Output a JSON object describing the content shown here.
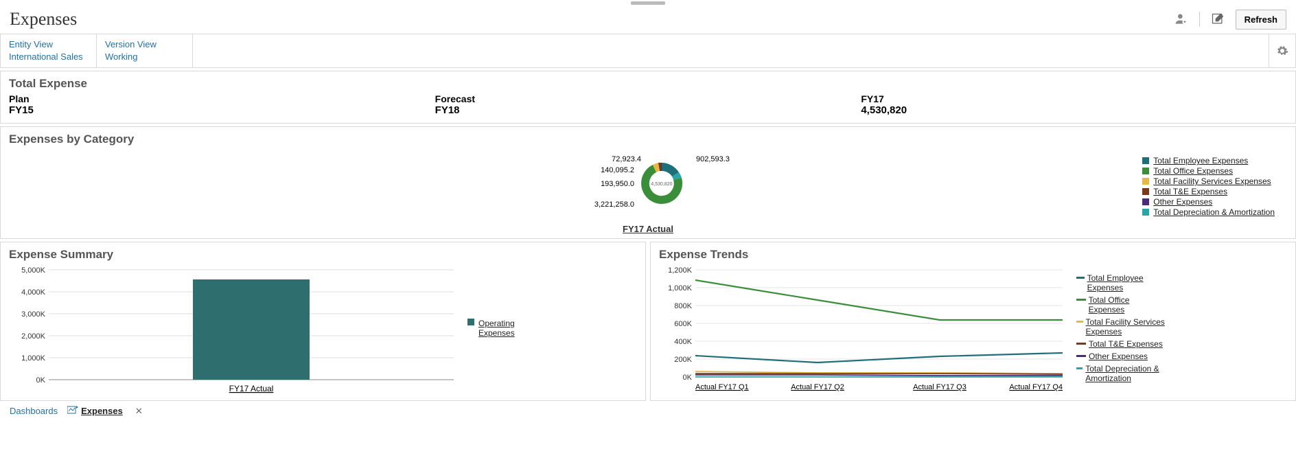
{
  "page_title": "Expenses",
  "refresh_label": "Refresh",
  "pov": {
    "entity": {
      "label": "Entity View",
      "value": "International Sales"
    },
    "version": {
      "label": "Version View",
      "value": "Working"
    }
  },
  "total_expense": {
    "title": "Total Expense",
    "cols": [
      {
        "label": "Plan",
        "value": "FY15"
      },
      {
        "label": "Forecast",
        "value": "FY18"
      },
      {
        "label": "FY17",
        "value": "4,530,820"
      }
    ]
  },
  "ebc": {
    "title": "Expenses by Category",
    "caption": "FY17 Actual",
    "center_value": "4,530,820",
    "labels": [
      "902,593.3",
      "72,923.4",
      "140,095.2",
      "193,950.0",
      "3,221,258.0"
    ],
    "legend": [
      {
        "color": "#1f6f78",
        "label": "Total Employee Expenses"
      },
      {
        "color": "#3a8e3a",
        "label": "Total Office Expenses"
      },
      {
        "color": "#e6b84a",
        "label": "Total Facility Services Expenses"
      },
      {
        "color": "#7a3a1a",
        "label": "Total T&E Expenses"
      },
      {
        "color": "#4a2a7a",
        "label": "Other Expenses"
      },
      {
        "color": "#2aa5a5",
        "label": "Total Depreciation & Amortization"
      }
    ]
  },
  "summary": {
    "title": "Expense Summary",
    "y_ticks": [
      "5,000K",
      "4,000K",
      "3,000K",
      "2,000K",
      "1,000K",
      "0K"
    ],
    "x_label": "FY17 Actual",
    "legend": [
      {
        "color": "#2e6e6e",
        "label": "Operating Expenses"
      }
    ]
  },
  "trends": {
    "title": "Expense Trends",
    "y_ticks": [
      "1,200K",
      "1,000K",
      "800K",
      "600K",
      "400K",
      "200K",
      "0K"
    ],
    "x_labels": [
      "Actual FY17 Q1",
      "Actual FY17 Q2",
      "Actual FY17 Q3",
      "Actual FY17 Q4"
    ],
    "legend": [
      {
        "color": "#1f6f78",
        "label": "Total Employee Expenses"
      },
      {
        "color": "#3a8e3a",
        "label": "Total Office Expenses"
      },
      {
        "color": "#e6b84a",
        "label": "Total Facility Services Expenses"
      },
      {
        "color": "#7a3a1a",
        "label": "Total T&E Expenses"
      },
      {
        "color": "#4a2a7a",
        "label": "Other Expenses"
      },
      {
        "color": "#2aa5a5",
        "label": "Total Depreciation & Amortization"
      }
    ]
  },
  "tabs": {
    "dashboards": "Dashboards",
    "expenses": "Expenses"
  },
  "chart_data": [
    {
      "type": "pie",
      "title": "Expenses by Category — FY17 Actual",
      "total": 4530820,
      "series": [
        {
          "name": "Total Employee Expenses",
          "value": 902593.3,
          "color": "#1f6f78"
        },
        {
          "name": "Total Office Expenses",
          "value": 3221258.0,
          "color": "#3a8e3a"
        },
        {
          "name": "Total Facility Services Expenses",
          "value": 193950.0,
          "color": "#e6b84a"
        },
        {
          "name": "Total T&E Expenses",
          "value": 140095.2,
          "color": "#7a3a1a"
        },
        {
          "name": "Other Expenses",
          "value": 72923.4,
          "color": "#4a2a7a"
        },
        {
          "name": "Total Depreciation & Amortization",
          "value": 0,
          "color": "#2aa5a5"
        }
      ]
    },
    {
      "type": "bar",
      "title": "Expense Summary",
      "categories": [
        "FY17 Actual"
      ],
      "series": [
        {
          "name": "Operating Expenses",
          "values": [
            4530820
          ],
          "color": "#2e6e6e"
        }
      ],
      "ylabel": "",
      "ylim": [
        0,
        5000000
      ]
    },
    {
      "type": "line",
      "title": "Expense Trends",
      "categories": [
        "Actual FY17 Q1",
        "Actual FY17 Q2",
        "Actual FY17 Q3",
        "Actual FY17 Q4"
      ],
      "series": [
        {
          "name": "Total Employee Expenses",
          "values": [
            240000,
            160000,
            230000,
            270000
          ],
          "color": "#1f6f78"
        },
        {
          "name": "Total Office Expenses",
          "values": [
            1080000,
            860000,
            640000,
            640000
          ],
          "color": "#3a8e3a"
        },
        {
          "name": "Total Facility Services Expenses",
          "values": [
            60000,
            50000,
            45000,
            40000
          ],
          "color": "#e6b84a"
        },
        {
          "name": "Total T&E Expenses",
          "values": [
            40000,
            35000,
            35000,
            30000
          ],
          "color": "#7a3a1a"
        },
        {
          "name": "Other Expenses",
          "values": [
            20000,
            20000,
            18000,
            15000
          ],
          "color": "#4a2a7a"
        },
        {
          "name": "Total Depreciation & Amortization",
          "values": [
            0,
            0,
            0,
            0
          ],
          "color": "#2aa5a5"
        }
      ],
      "ylim": [
        0,
        1200000
      ]
    }
  ]
}
